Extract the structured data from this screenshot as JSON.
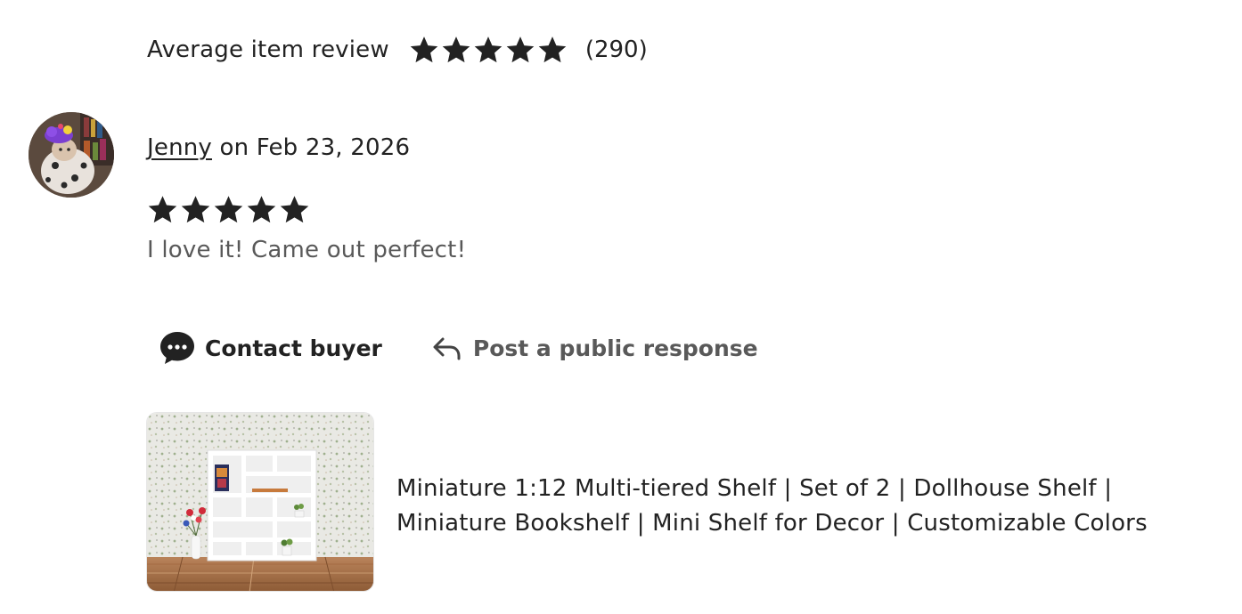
{
  "summary": {
    "label": "Average item review",
    "rating": 5,
    "count": "(290)"
  },
  "review": {
    "avatar_icon": "reviewer-avatar",
    "reviewer_name": "Jenny",
    "date_text": " on Feb 23, 2026",
    "rating": 5,
    "text": "I love it! Came out perfect!"
  },
  "actions": {
    "contact_label": "Contact buyer",
    "contact_icon": "chat-bubble-icon",
    "post_label": "Post a public response",
    "post_icon": "reply-arrow-icon"
  },
  "listing": {
    "title": "Miniature 1:12 Multi-tiered Shelf | Set of 2 | Dollhouse Shelf | Miniature Bookshelf | Mini Shelf for Decor | Customizable Colors"
  },
  "colors": {
    "text": "#222222",
    "muted": "#595959",
    "star": "#222222"
  }
}
